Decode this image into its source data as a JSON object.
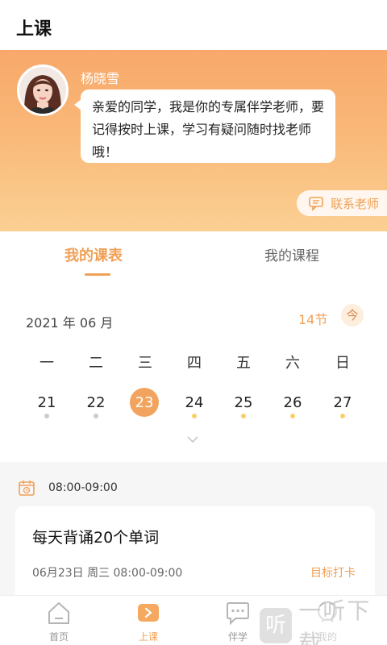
{
  "header": {
    "title": "上课"
  },
  "teacher": {
    "name": "杨晓雪",
    "message": "亲爱的同学，我是你的专属伴学老师，要记得按时上课，学习有疑问随时找老师哦！",
    "contact_label": "联系老师"
  },
  "tabs": [
    {
      "label": "我的课表",
      "active": true
    },
    {
      "label": "我的课程",
      "active": false
    }
  ],
  "calendar": {
    "month": "2021 年 06 月",
    "lesson_count": "14节",
    "today_label": "今",
    "weekdays": [
      "一",
      "二",
      "三",
      "四",
      "五",
      "六",
      "日"
    ],
    "days": [
      "21",
      "22",
      "23",
      "24",
      "25",
      "26",
      "27"
    ],
    "selected_day": "23",
    "day_dots": [
      "grey",
      "grey",
      "none",
      "yellow",
      "yellow",
      "yellow",
      "yellow"
    ]
  },
  "schedule": {
    "time_range": "08:00-09:00",
    "card": {
      "title": "每天背诵20个单词",
      "meta": "06月23日   周三   08:00-09:00",
      "action": "目标打卡"
    }
  },
  "bottom_nav": [
    {
      "label": "首页",
      "icon": "home-icon",
      "active": false
    },
    {
      "label": "上课",
      "icon": "play-icon",
      "active": true
    },
    {
      "label": "伴学",
      "icon": "chat-icon",
      "active": false
    },
    {
      "label": "我的",
      "icon": "profile-icon",
      "active": false
    }
  ],
  "watermark": {
    "icon_text": "听",
    "text": "一听下载"
  },
  "colors": {
    "accent": "#f0a055",
    "banner_top": "#f8a86a",
    "banner_bottom": "#fbd093"
  }
}
